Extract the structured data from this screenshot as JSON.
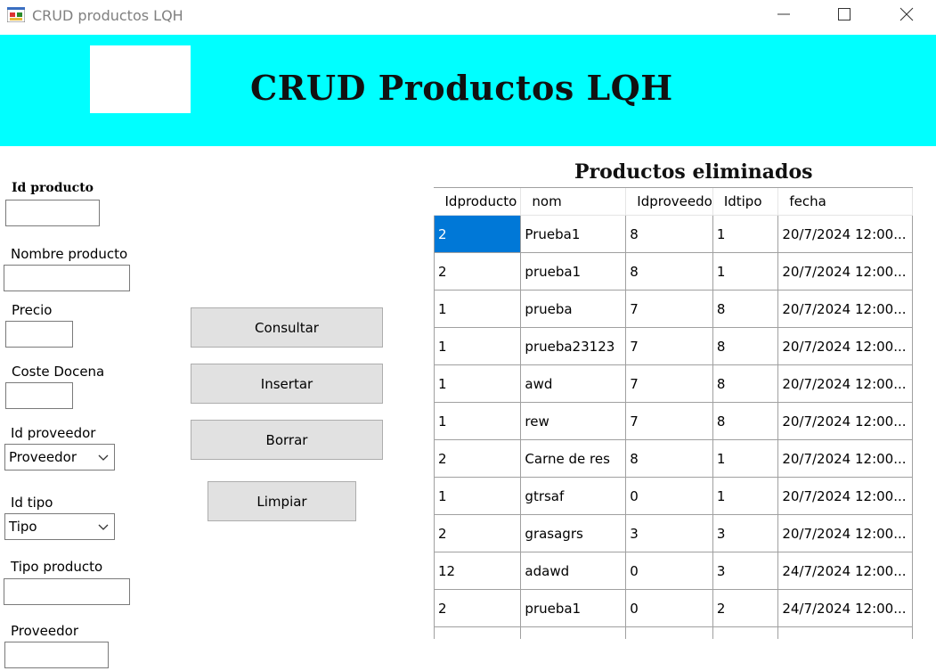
{
  "window": {
    "title": "CRUD productos LQH"
  },
  "header": {
    "title": "CRUD Productos LQH"
  },
  "form": {
    "id_producto_label": "Id producto",
    "id_producto_value": "",
    "nombre_label": "Nombre producto",
    "nombre_value": "",
    "precio_label": "Precio",
    "precio_value": "",
    "coste_label": "Coste Docena",
    "coste_value": "",
    "id_proveedor_label": "Id proveedor",
    "id_proveedor_selected": "Proveedor",
    "id_tipo_label": "Id tipo",
    "id_tipo_selected": "Tipo",
    "tipo_producto_label": "Tipo producto",
    "tipo_producto_value": "",
    "proveedor_label": "Proveedor",
    "proveedor_value": ""
  },
  "buttons": {
    "consultar": "Consultar",
    "insertar": "Insertar",
    "borrar": "Borrar",
    "limpiar": "Limpiar"
  },
  "grid": {
    "title": "Productos eliminados",
    "columns": [
      "Idproducto",
      "nom",
      "Idproveedo",
      "Idtipo",
      "fecha"
    ],
    "rows": [
      [
        "2",
        "Prueba1",
        "8",
        "1",
        "20/7/2024 12:00..."
      ],
      [
        "2",
        "prueba1",
        "8",
        "1",
        "20/7/2024 12:00..."
      ],
      [
        "1",
        "prueba",
        "7",
        "8",
        "20/7/2024 12:00..."
      ],
      [
        "1",
        "prueba23123",
        "7",
        "8",
        "20/7/2024 12:00..."
      ],
      [
        "1",
        "awd",
        "7",
        "8",
        "20/7/2024 12:00..."
      ],
      [
        "1",
        "rew",
        "7",
        "8",
        "20/7/2024 12:00..."
      ],
      [
        "2",
        "Carne de res",
        "8",
        "1",
        "20/7/2024 12:00..."
      ],
      [
        "1",
        "gtrsaf",
        "0",
        "1",
        "20/7/2024 12:00..."
      ],
      [
        "2",
        "grasagrs",
        "3",
        "3",
        "20/7/2024 12:00..."
      ],
      [
        "12",
        "adawd",
        "0",
        "3",
        "24/7/2024 12:00..."
      ],
      [
        "2",
        "prueba1",
        "0",
        "2",
        "24/7/2024 12:00..."
      ],
      [
        "",
        "",
        "",
        "",
        ""
      ]
    ]
  },
  "colors": {
    "banner": "#00ffff",
    "selection": "#0078d7",
    "button_face": "#e1e1e1"
  },
  "icons": [
    "app-icon",
    "minimize-icon",
    "maximize-icon",
    "close-icon",
    "chevron-down-icon"
  ]
}
